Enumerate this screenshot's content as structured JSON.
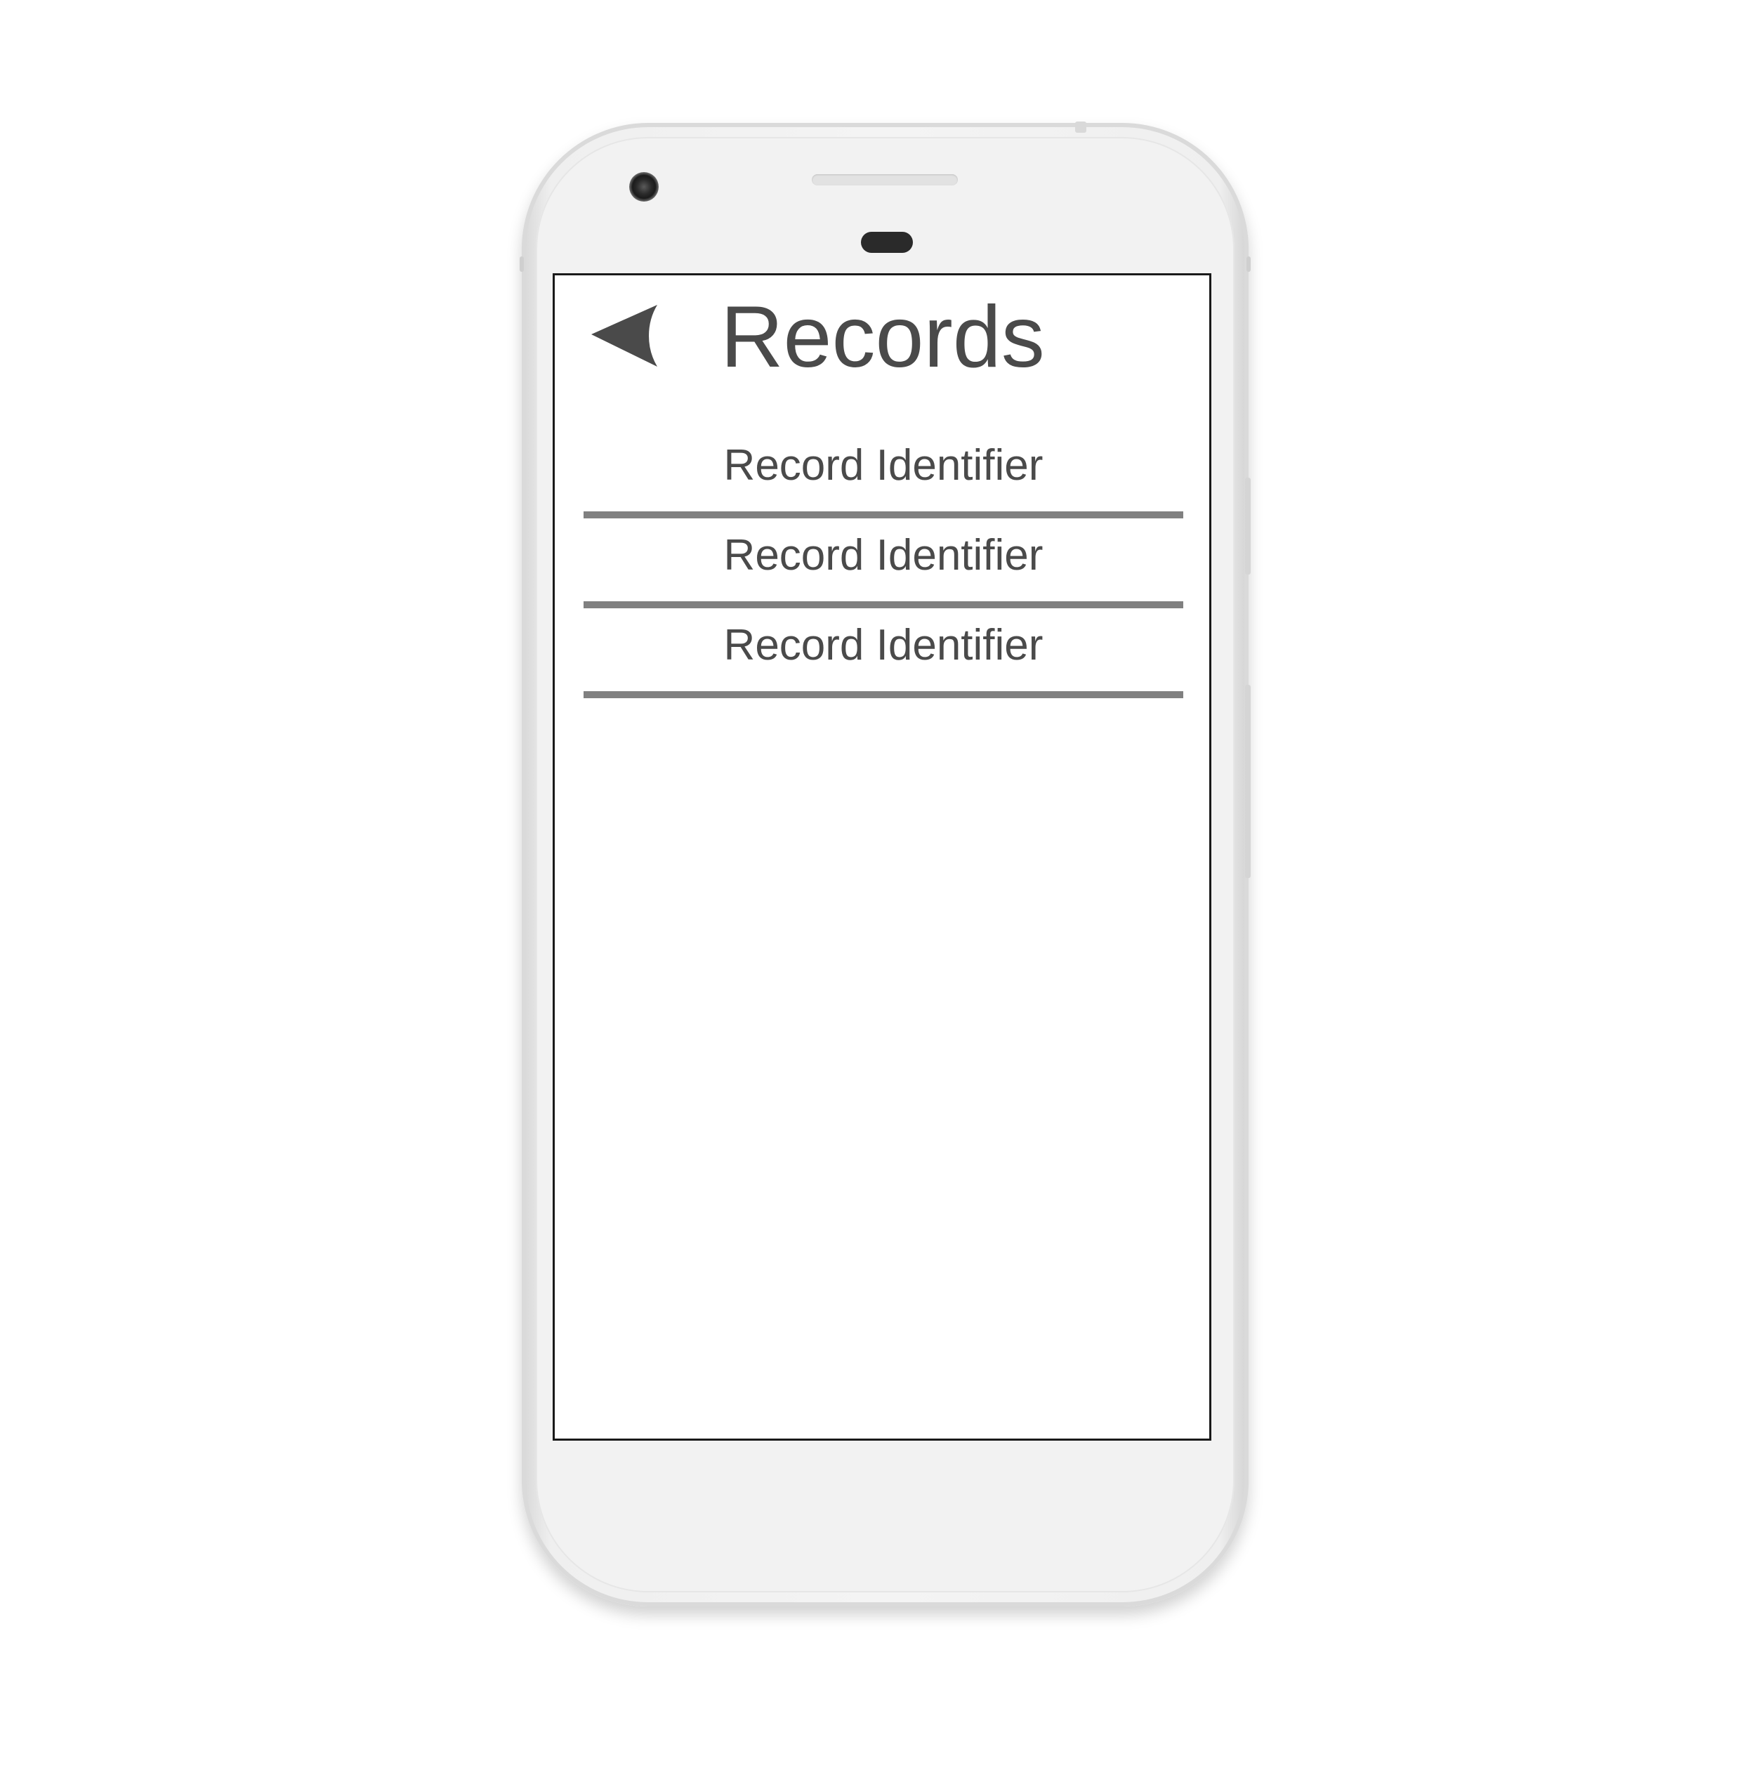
{
  "header": {
    "back_icon": "back-arrow-icon",
    "title": "Records"
  },
  "records": [
    {
      "label": "Record Identifier"
    },
    {
      "label": "Record Identifier"
    },
    {
      "label": "Record Identifier"
    }
  ],
  "colors": {
    "text": "#4a4a4a",
    "divider": "#808080",
    "screen_border": "#1a1a1a",
    "phone_body": "#f2f2f2"
  }
}
